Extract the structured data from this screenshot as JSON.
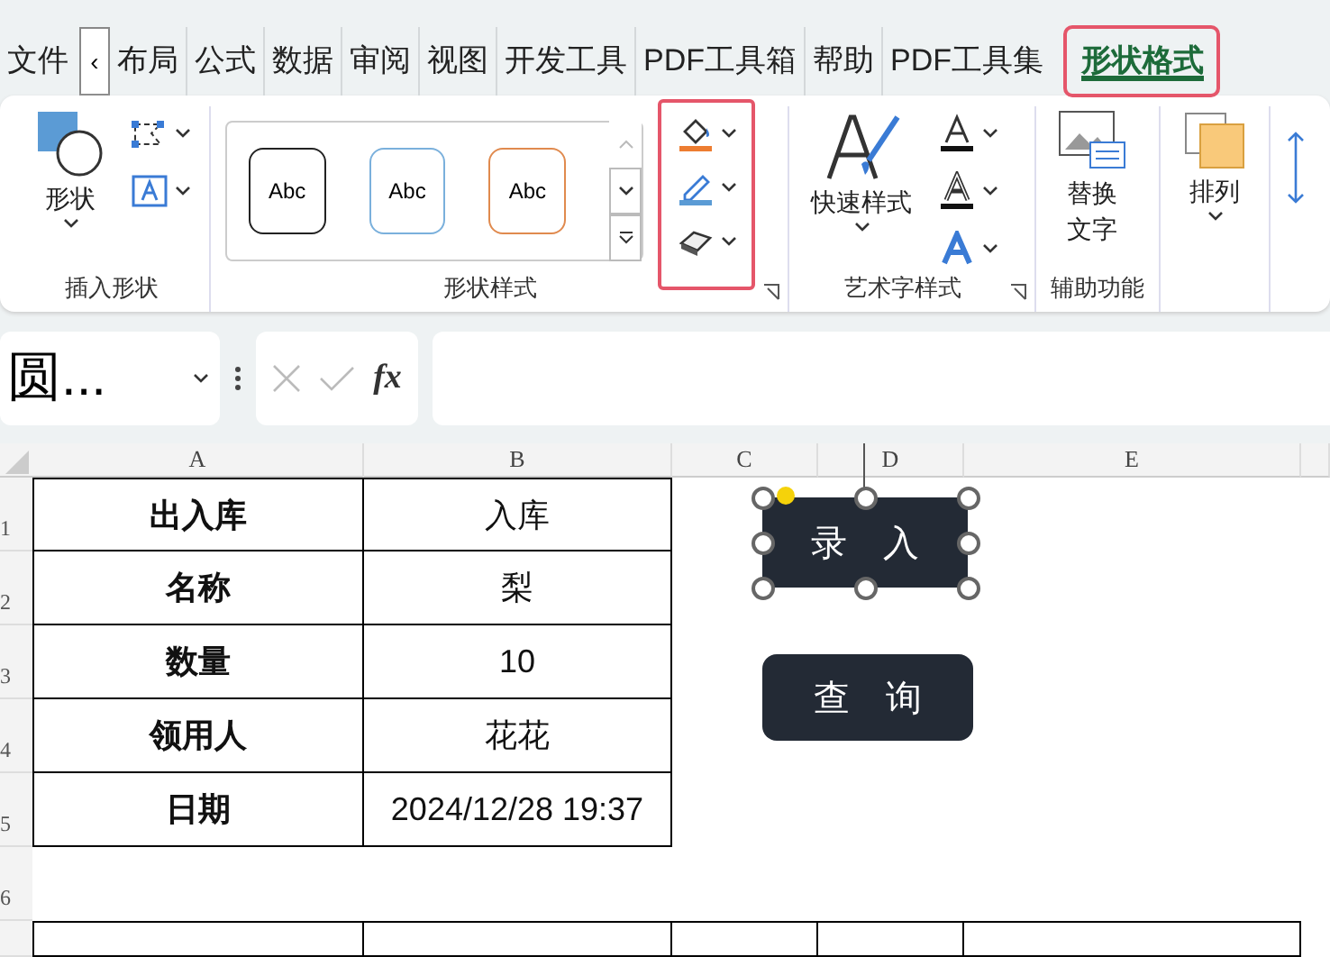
{
  "tabs": [
    {
      "label": "文件",
      "selected": false,
      "highlighted": false
    },
    {
      "label": "布局",
      "selected": false,
      "highlighted": false
    },
    {
      "label": "公式",
      "selected": false,
      "highlighted": false
    },
    {
      "label": "数据",
      "selected": false,
      "highlighted": false
    },
    {
      "label": "审阅",
      "selected": false,
      "highlighted": false
    },
    {
      "label": "视图",
      "selected": false,
      "highlighted": false
    },
    {
      "label": "开发工具",
      "selected": false,
      "highlighted": false
    },
    {
      "label": "PDF工具箱",
      "selected": false,
      "highlighted": false
    },
    {
      "label": "帮助",
      "selected": false,
      "highlighted": false
    },
    {
      "label": "PDF工具集",
      "selected": false,
      "highlighted": false
    },
    {
      "label": "形状格式",
      "selected": true,
      "highlighted": true
    }
  ],
  "tab_scroll": {
    "label": "‹"
  },
  "ribbon": {
    "insert_shapes": {
      "label": "插入形状",
      "shape_button": "形状"
    },
    "shape_styles": {
      "label": "形状样式",
      "presets": [
        {
          "label": "Abc",
          "color": "#222222"
        },
        {
          "label": "Abc",
          "color": "#7ab0dc"
        },
        {
          "label": "Abc",
          "color": "#e08a4e"
        }
      ],
      "format_buttons_highlighted": true
    },
    "wordart_styles": {
      "label": "艺术字样式",
      "quick_styles": "快速样式"
    },
    "accessibility": {
      "label": "辅助功能",
      "alt_text": "替换文字"
    },
    "arrange": {
      "label": "排列"
    }
  },
  "formula_bar": {
    "name_box": "圆...",
    "fx": "fx"
  },
  "sheet": {
    "columns": [
      "A",
      "B",
      "C",
      "D",
      "E"
    ],
    "row_numbers": [
      "1",
      "2",
      "3",
      "4",
      "5",
      "6"
    ],
    "table": [
      {
        "label": "出入库",
        "value": "入库"
      },
      {
        "label": "名称",
        "value": "梨"
      },
      {
        "label": "数量",
        "value": "10"
      },
      {
        "label": "领用人",
        "value": "花花"
      },
      {
        "label": "日期",
        "value": "2024/12/28 19:37"
      }
    ],
    "shapes": [
      {
        "label": "录　入",
        "selected": true
      },
      {
        "label": "查　询",
        "selected": false
      }
    ]
  }
}
